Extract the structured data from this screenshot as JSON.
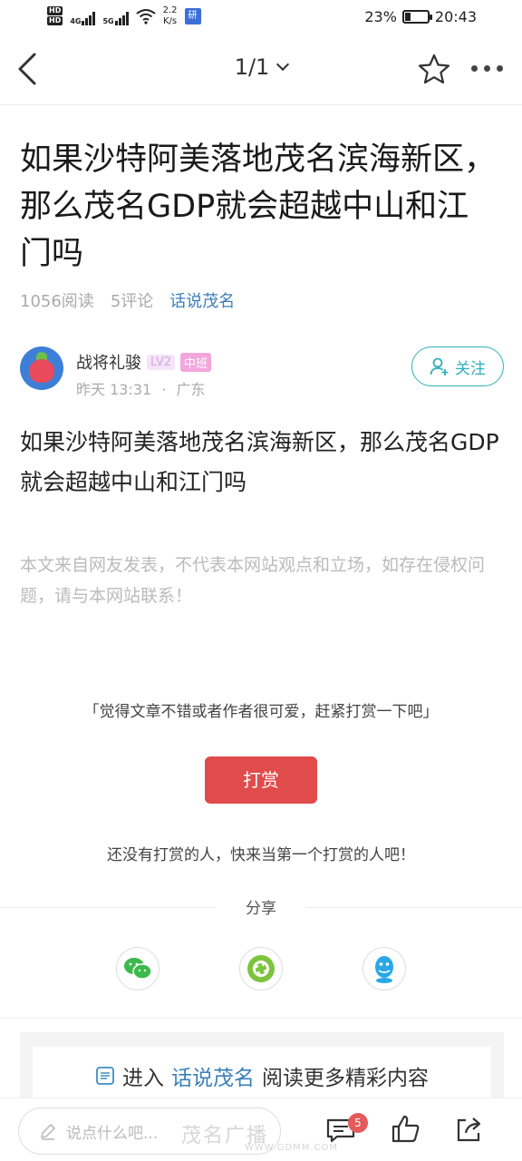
{
  "statusbar": {
    "hd1": "HD",
    "hd2": "HD",
    "sig1": "4G",
    "sig2": "5G",
    "speed_value": "2.2",
    "speed_unit": "K/s",
    "app_glyph": "研",
    "battery": "23%",
    "time": "20:43"
  },
  "nav": {
    "page_indicator": "1/1"
  },
  "article": {
    "title": "如果沙特阿美落地茂名滨海新区，那么茂名GDP就会超越中山和江门吗",
    "reads": "1056阅读",
    "comments": "5评论",
    "forum": "话说茂名",
    "body": "如果沙特阿美落地茂名滨海新区，那么茂名GDP就会超越中山和江门吗",
    "disclaimer": "本文来自网友发表，不代表本网站观点和立场，如存在侵权问题，请与本网站联系！"
  },
  "author": {
    "name": "战将礼骏",
    "level": "LV2",
    "rank": "中班",
    "time": "昨天 13:31",
    "separator": "·",
    "location": "广东",
    "follow_label": "关注"
  },
  "reward": {
    "quote": "「觉得文章不错或者作者很可爱，赶紧打赏一下吧」",
    "button": "打赏",
    "empty": "还没有打赏的人，快来当第一个打赏的人吧！"
  },
  "share": {
    "label": "分享",
    "icons": [
      "wechat-icon",
      "moments-icon",
      "qq-icon"
    ]
  },
  "forum_box": {
    "prefix": "进入",
    "forum": "话说茂名",
    "suffix": "阅读更多精彩内容"
  },
  "bottombar": {
    "comment_placeholder": "说点什么吧...",
    "comment_count": "5"
  },
  "watermark": {
    "text": "茂名广播",
    "url": "WWW.GDMM.COM"
  },
  "colors": {
    "accent_teal": "#2fb0b8",
    "link_blue": "#3b7fb8",
    "reward_red": "#e04b4b",
    "share_green": "#3cb94b"
  }
}
